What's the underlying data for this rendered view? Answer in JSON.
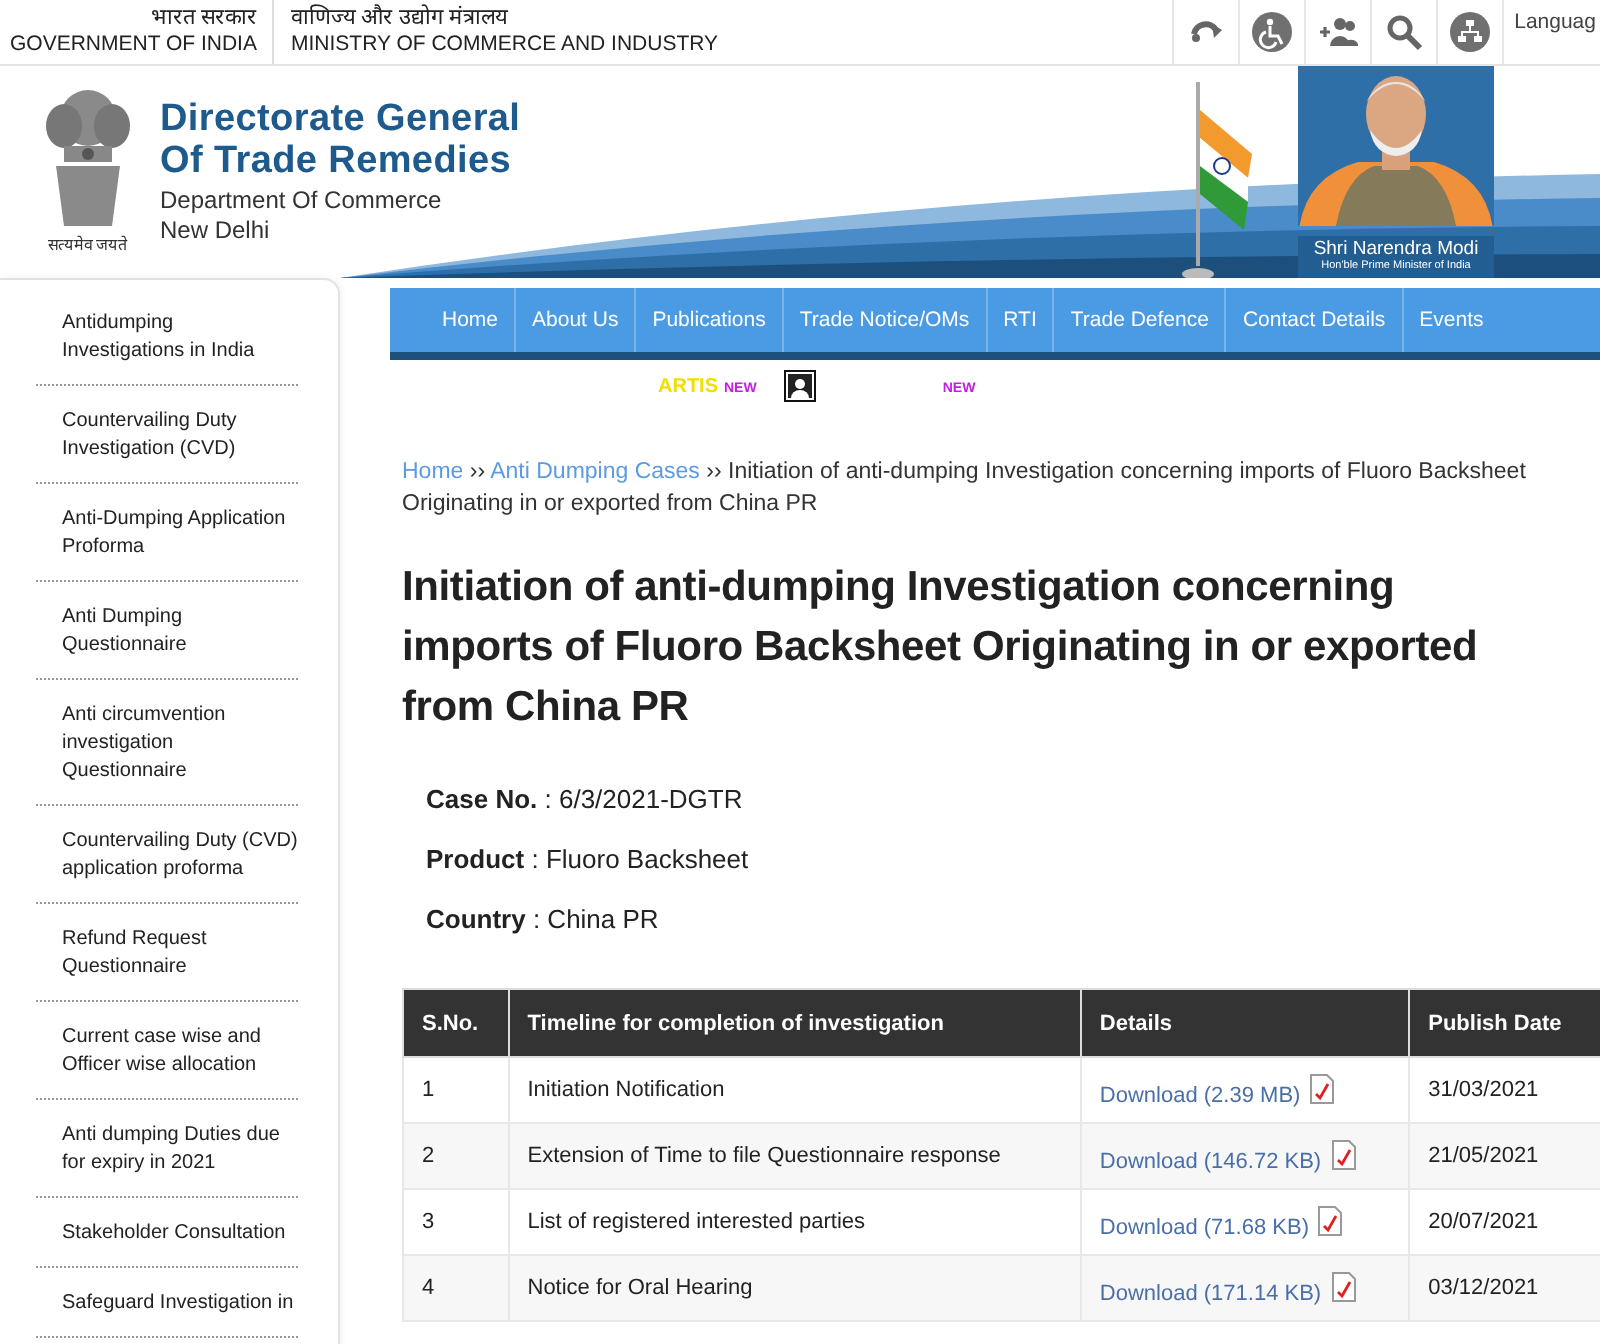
{
  "top_bar": {
    "gov_hindi": "भारत सरकार",
    "gov_english": "GOVERNMENT OF INDIA",
    "ministry_hindi": "वाणिज्य और उद्योग मंत्रालय",
    "ministry_english": "MINISTRY OF COMMERCE AND INDUSTRY",
    "language": "Languag"
  },
  "header": {
    "title_line_1": "Directorate General",
    "title_line_2": "Of Trade Remedies",
    "department": "Department Of Commerce",
    "city": "New Delhi",
    "motto": "सत्यमेव जयते",
    "caption_name": "Shri Narendra Modi",
    "caption_role": "Hon'ble Prime Minister of India"
  },
  "nav": [
    "Home",
    "About Us",
    "Publications",
    "Trade Notice/OMs",
    "RTI",
    "Trade Defence",
    "Contact Details",
    "Events"
  ],
  "sub_nav": [
    {
      "kind": "text",
      "label": "ARTIS"
    },
    {
      "kind": "badge",
      "label": "NEW"
    },
    {
      "kind": "icon"
    },
    {
      "kind": "badge",
      "label": "NEW"
    }
  ],
  "sidebar": [
    "Antidumping Investigations in India",
    "Countervailing Duty Investigation (CVD)",
    "Anti-Dumping Application Proforma",
    "Anti Dumping Questionnaire",
    "Anti circumvention investigation Questionnaire",
    "Countervailing Duty (CVD) application proforma",
    "Refund Request Questionnaire",
    "Current case wise and Officer wise allocation",
    "Anti dumping Duties due for expiry in 2021",
    "Stakeholder Consultation",
    "Safeguard Investigation in"
  ],
  "breadcrumb": {
    "links": [
      "Home",
      "Anti Dumping Cases"
    ],
    "separator": "››",
    "current": "Initiation of anti-dumping Investigation concerning imports of Fluoro Backsheet Originating in or exported from China PR"
  },
  "title": "Initiation of anti-dumping Investigation concerning imports of Fluoro Backsheet Originating in or exported from China PR",
  "case_info": [
    "**Case No.** : 6/3/2021-DGTR",
    "**Product** : Fluoro Backsheet",
    "**Country** : China PR"
  ],
  "table": {
    "columns": [
      "S.No.",
      "Timeline for completion of investigation",
      "Details",
      "Publish Date"
    ],
    "rows": [
      {
        "sno": "1",
        "timeline": "Initiation Notification",
        "download": "Download (2.39 MB)",
        "date": "31/03/2021"
      },
      {
        "sno": "2",
        "timeline": "Extension of Time to file Questionnaire response",
        "download": "Download (146.72 KB)",
        "date": "21/05/2021"
      },
      {
        "sno": "3",
        "timeline": "List of registered interested parties",
        "download": "Download (71.68 KB)",
        "date": "20/07/2021"
      },
      {
        "sno": "4",
        "timeline": "Notice for Oral Hearing",
        "download": "Download (171.14 KB)",
        "date": "03/12/2021"
      }
    ]
  }
}
